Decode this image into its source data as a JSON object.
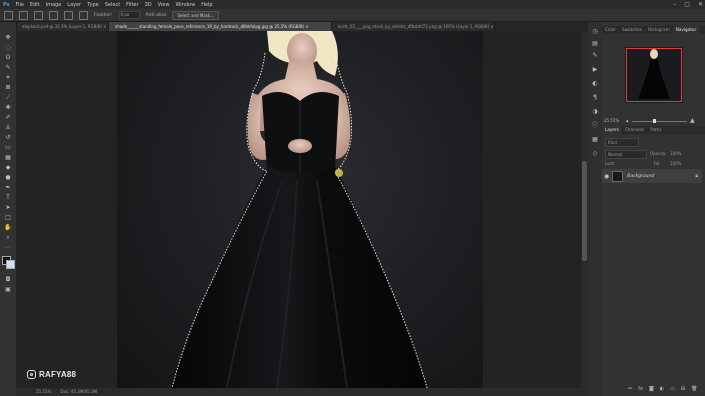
{
  "menubar": {
    "app_icon": "ps-logo-icon",
    "items": [
      "File",
      "Edit",
      "Image",
      "Layer",
      "Type",
      "Select",
      "Filter",
      "3D",
      "View",
      "Window",
      "Help"
    ],
    "window_controls": [
      "–",
      "▢",
      "✕"
    ]
  },
  "options_bar": {
    "feather_label": "Feather:",
    "feather_value": "0 px",
    "antialias_label": "Anti-alias",
    "select_mask_label": "Select and Mask..."
  },
  "document_tabs": [
    {
      "label": "elephant.psd @ 33.3% (Layer 1, RGB/8) ×",
      "active": false
    },
    {
      "label": "shade______standing_female_pose_reference_19_by_hardrock_d6hkfoipg.jpg @ 25.5% (RGB/8) ×",
      "active": true
    },
    {
      "label": "birds_02____png_stock_by_wikstic_dfbsbfd72.png @ 100% (Layer 1, RGB/8) ×",
      "active": false
    }
  ],
  "status": {
    "zoom": "25.51%",
    "doc_size": "Doc: 45.3M/45.3M"
  },
  "panels": {
    "top_tabs": [
      "Color",
      "Swatches",
      "Histogram",
      "Navigator"
    ],
    "navigator_zoom": "25.51%",
    "layer_tabs": [
      "Layers",
      "Channels",
      "Paths"
    ],
    "kind_label": "Kind",
    "blend_mode": "Normal",
    "opacity_label": "Opacity:",
    "opacity_value": "100%",
    "lock_label": "Lock:",
    "fill_label": "Fill:",
    "fill_value": "100%",
    "layers": [
      {
        "name": "Background",
        "visible": true,
        "locked": true
      }
    ]
  },
  "watermark": {
    "text": "RAFYA88"
  },
  "colors": {
    "accent": "#e23c3c",
    "selection_marching_ants": "#ffffff"
  }
}
